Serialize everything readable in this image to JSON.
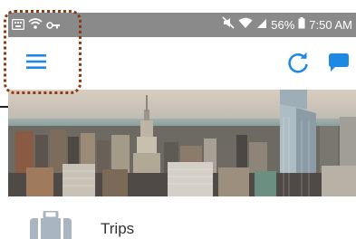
{
  "status_bar": {
    "battery": "56%",
    "time": "7:50 AM"
  },
  "app_bar": {
    "menu_icon": "hamburger-menu-icon",
    "refresh_icon": "refresh-icon",
    "chat_icon": "chat-bubble-icon",
    "accent_color": "#1e88e5"
  },
  "hero": {
    "description_icon": "city-skyline-image"
  },
  "list": {
    "items": [
      {
        "label": "Trips",
        "icon": "suitcase-icon"
      }
    ]
  },
  "colors": {
    "status_bar_bg": "#8a8a8a",
    "highlight_border": "#8b3a12",
    "icon_gray": "#a9b6c2"
  }
}
